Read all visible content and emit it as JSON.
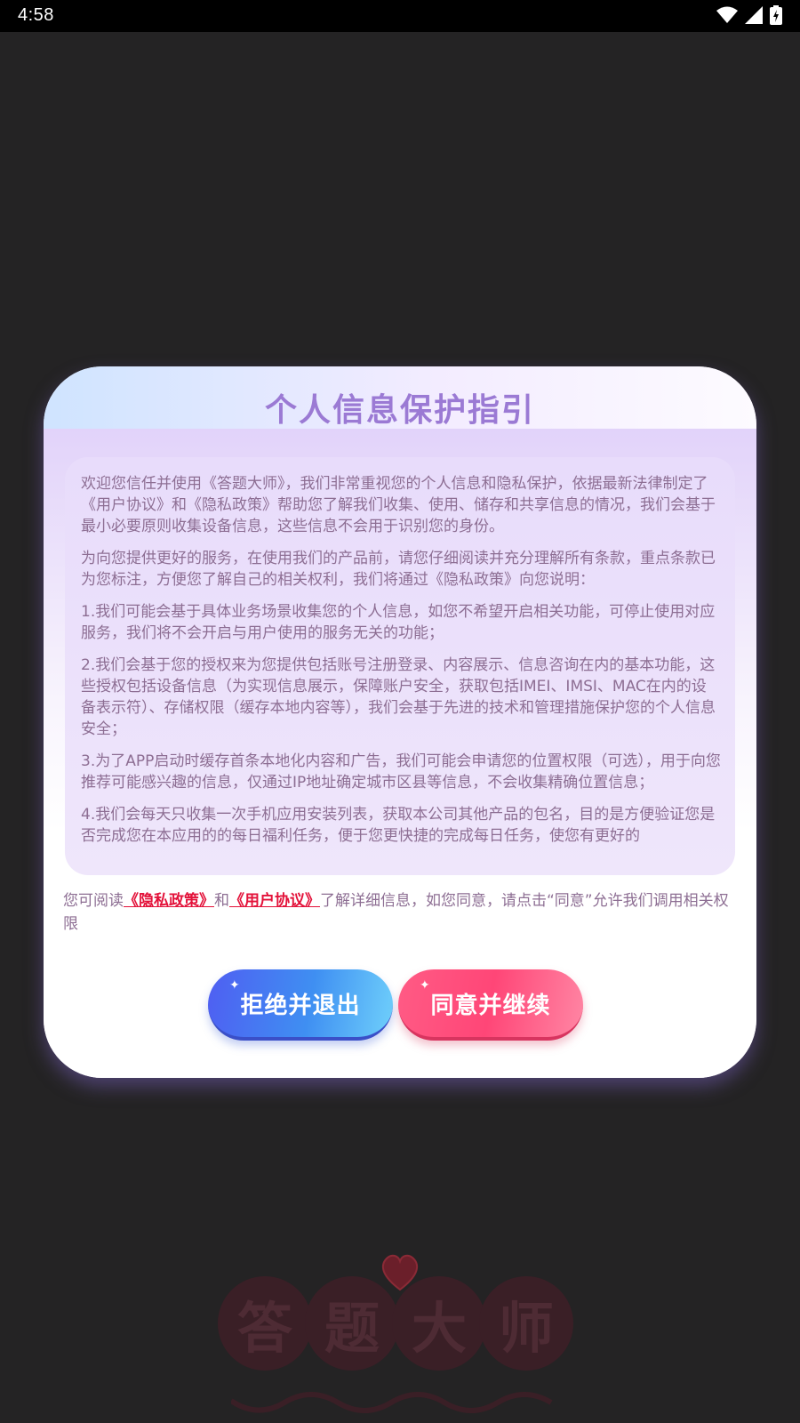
{
  "status_bar": {
    "time": "4:58",
    "icons": [
      "wifi-icon",
      "signal-icon",
      "battery-icon"
    ]
  },
  "background_logo": {
    "chars": [
      "答",
      "题",
      "大",
      "师"
    ]
  },
  "dialog": {
    "title": "个人信息保护指引",
    "paragraphs": [
      "欢迎您信任并使用《答题大师》，我们非常重视您的个人信息和隐私保护，依据最新法律制定了《用户协议》和《隐私政策》帮助您了解我们收集、使用、储存和共享信息的情况，我们会基于最小必要原则收集设备信息，这些信息不会用于识别您的身份。",
      "为向您提供更好的服务，在使用我们的产品前，请您仔细阅读并充分理解所有条款，重点条款已为您标注，方便您了解自己的相关权利，我们将通过《隐私政策》向您说明：",
      "1.我们可能会基于具体业务场景收集您的个人信息，如您不希望开启相关功能，可停止使用对应服务，我们将不会开启与用户使用的服务无关的功能；",
      "2.我们会基于您的授权来为您提供包括账号注册登录、内容展示、信息咨询在内的基本功能，这些授权包括设备信息（为实现信息展示，保障账户安全，获取包括IMEI、IMSI、MAC在内的设备表示符）、存储权限（缓存本地内容等），我们会基于先进的技术和管理措施保护您的个人信息安全；",
      "3.为了APP启动时缓存首条本地化内容和广告，我们可能会申请您的位置权限（可选），用于向您推荐可能感兴趣的信息，仅通过IP地址确定城市区县等信息，不会收集精确位置信息；",
      "4.我们会每天只收集一次手机应用安装列表，获取本公司其他产品的包名，目的是方便验证您是否完成您在本应用的的每日福利任务，便于您更快捷的完成每日任务，使您有更好的"
    ],
    "footer": {
      "prefix": "您可阅读",
      "privacy_link": "《隐私政策》",
      "middle": "和",
      "agreement_link": "《用户协议》",
      "suffix": "了解详细信息，如您同意，请点击“同意”允许我们调用相关权限"
    },
    "buttons": {
      "reject": "拒绝并退出",
      "agree": "同意并继续"
    }
  },
  "colors": {
    "title": "#9b7ad4",
    "body_text": "#8d6e93",
    "link": "#e3123a",
    "reject_button": "#4f5ef2",
    "agree_button": "#ff4677"
  }
}
